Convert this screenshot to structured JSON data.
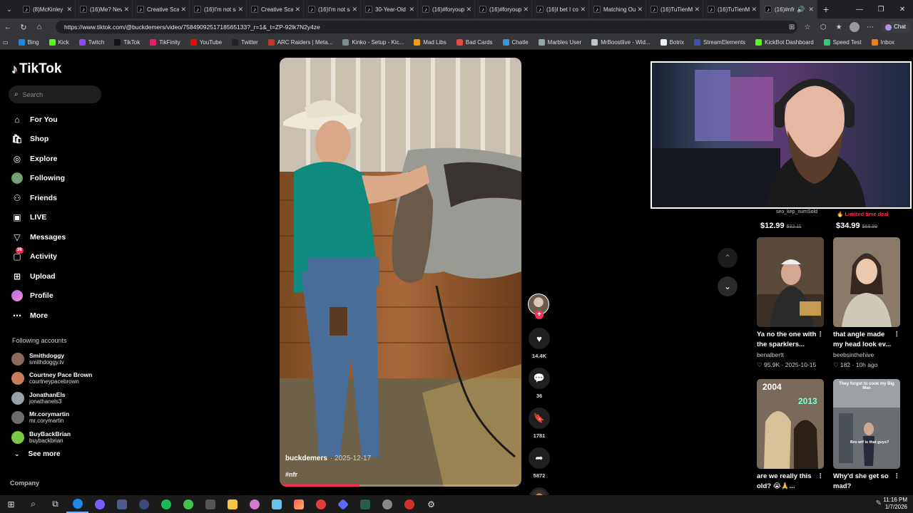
{
  "browser": {
    "tabs": [
      {
        "label": "(8)McKinley sh",
        "icon": "tiktok-icon",
        "active": false
      },
      {
        "label": "(16)Me? Never",
        "icon": "tiktok-icon",
        "active": false
      },
      {
        "label": "Creative Scans",
        "icon": "tiktok-icon",
        "active": false
      },
      {
        "label": "(16)I'm not sa",
        "icon": "tiktok-icon",
        "active": false
      },
      {
        "label": "Creative Scans",
        "icon": "tiktok-icon",
        "active": false
      },
      {
        "label": "(16)I'm not sa",
        "icon": "tiktok-icon",
        "active": false
      },
      {
        "label": "30-Year-Old Ri",
        "icon": "tiktok-icon",
        "active": false
      },
      {
        "label": "(16)#foryoupa",
        "icon": "tiktok-icon",
        "active": false
      },
      {
        "label": "(16)#foryoup",
        "icon": "tiktok-icon",
        "active": false
      },
      {
        "label": "(16)I bet I cou",
        "icon": "tiktok-icon",
        "active": false
      },
      {
        "label": "Matching Out",
        "icon": "tiktok-icon",
        "active": false
      },
      {
        "label": "(16)TuTienMi",
        "icon": "tiktok-icon",
        "active": false
      },
      {
        "label": "(16)TuTienMo",
        "icon": "tiktok-icon",
        "active": false
      },
      {
        "label": "(16)#nfr",
        "icon": "tiktok-icon",
        "active": true
      }
    ],
    "url": "https://www.tiktok.com/@buckdemers/video/7584909251718565133?_r=1&_t=ZP-92lk7N2y4ze",
    "chat_label": "Chat",
    "bookmarks": [
      {
        "label": "Bing",
        "color": "#1e88e5"
      },
      {
        "label": "Kick",
        "color": "#53fc18"
      },
      {
        "label": "Twitch",
        "color": "#9146ff"
      },
      {
        "label": "TikTok",
        "color": "#111111"
      },
      {
        "label": "TikFinity",
        "color": "#e91e63"
      },
      {
        "label": "YouTube",
        "color": "#ff0000"
      },
      {
        "label": "Twitter",
        "color": "#222222"
      },
      {
        "label": "ARC Raiders | Meta...",
        "color": "#c0392b"
      },
      {
        "label": "Kinko - Setup - Kic...",
        "color": "#7f8c8d"
      },
      {
        "label": "Mad Libs",
        "color": "#f39c12"
      },
      {
        "label": "Bad Cards",
        "color": "#e74c3c"
      },
      {
        "label": "Chatle",
        "color": "#3498db"
      },
      {
        "label": "Marbles User",
        "color": "#95a5a6"
      },
      {
        "label": "MrBoostlive - Wid...",
        "color": "#bdc3c7"
      },
      {
        "label": "Botrix",
        "color": "#ecf0f1"
      },
      {
        "label": "StreamElements",
        "color": "#3f51b5"
      },
      {
        "label": "KickBot Dashboard",
        "color": "#53fc18"
      },
      {
        "label": "Speed Test",
        "color": "#2ecc71"
      },
      {
        "label": "Inbox",
        "color": "#e67e22"
      }
    ]
  },
  "sidebar": {
    "logo": "TikTok",
    "search_placeholder": "Search",
    "nav": [
      {
        "label": "For You",
        "icon": "home-icon"
      },
      {
        "label": "Shop",
        "icon": "shop-bag-icon"
      },
      {
        "label": "Explore",
        "icon": "compass-icon"
      },
      {
        "label": "Following",
        "icon": "following-avatar"
      },
      {
        "label": "Friends",
        "icon": "friends-icon"
      },
      {
        "label": "LIVE",
        "icon": "live-icon"
      },
      {
        "label": "Messages",
        "icon": "messages-icon"
      },
      {
        "label": "Activity",
        "icon": "activity-icon",
        "badge": "36"
      },
      {
        "label": "Upload",
        "icon": "upload-icon"
      },
      {
        "label": "Profile",
        "icon": "profile-avatar"
      },
      {
        "label": "More",
        "icon": "more-dots-icon"
      }
    ],
    "following_title": "Following accounts",
    "following": [
      {
        "name": "Smithdoggy",
        "handle": "smithdoggy.tv",
        "color": "#8c6b5a"
      },
      {
        "name": "Courtney Pace Brown",
        "handle": "courtneypacebrown",
        "color": "#c97b5c"
      },
      {
        "name": "JonathanEls",
        "handle": "jonathanels3",
        "color": "#9aa0a6"
      },
      {
        "name": "Mr.corymartin",
        "handle": "mr.corymartin",
        "color": "#6d6d6d"
      },
      {
        "name": "BuyBackBrian",
        "handle": "buybackbrian",
        "color": "#7ac943"
      }
    ],
    "see_more": "See more",
    "company": "Company"
  },
  "video": {
    "author": "buckdemers",
    "date": "· 2025-12-17",
    "tag": "#nfr",
    "progress": 0.33
  },
  "actions": {
    "likes": "14.4K",
    "comments": "36",
    "saves": "1781",
    "shares": "5872"
  },
  "shop": {
    "seller_label": "seo_kep_numSold",
    "limited_label": "Limited time deal",
    "price1": "$12.99",
    "price1_old": "$32.11",
    "price2": "$34.99",
    "price2_old": "$69.99"
  },
  "recommended": [
    {
      "title": "Ya no the one with the sparklers...",
      "user": "benalbertt",
      "stats": "♡ 95.9K · 2025-10-15"
    },
    {
      "title": "that angle made my head look ev...",
      "user": "beebsinthehive",
      "stats": "♡ 182 · 10h ago"
    },
    {
      "title": "are we really this old? 😭🙏...",
      "user": "",
      "stats": "",
      "overlay1": "2004",
      "overlay2": "2013"
    },
    {
      "title": "Why'd she get so mad?",
      "user": "",
      "stats": "",
      "overlay1": "They forgot to cook my Big Mac",
      "overlay2": "Bro wtf is that guys?"
    }
  ],
  "taskbar": {
    "time": "11:16 PM",
    "date": "1/7/2026"
  }
}
